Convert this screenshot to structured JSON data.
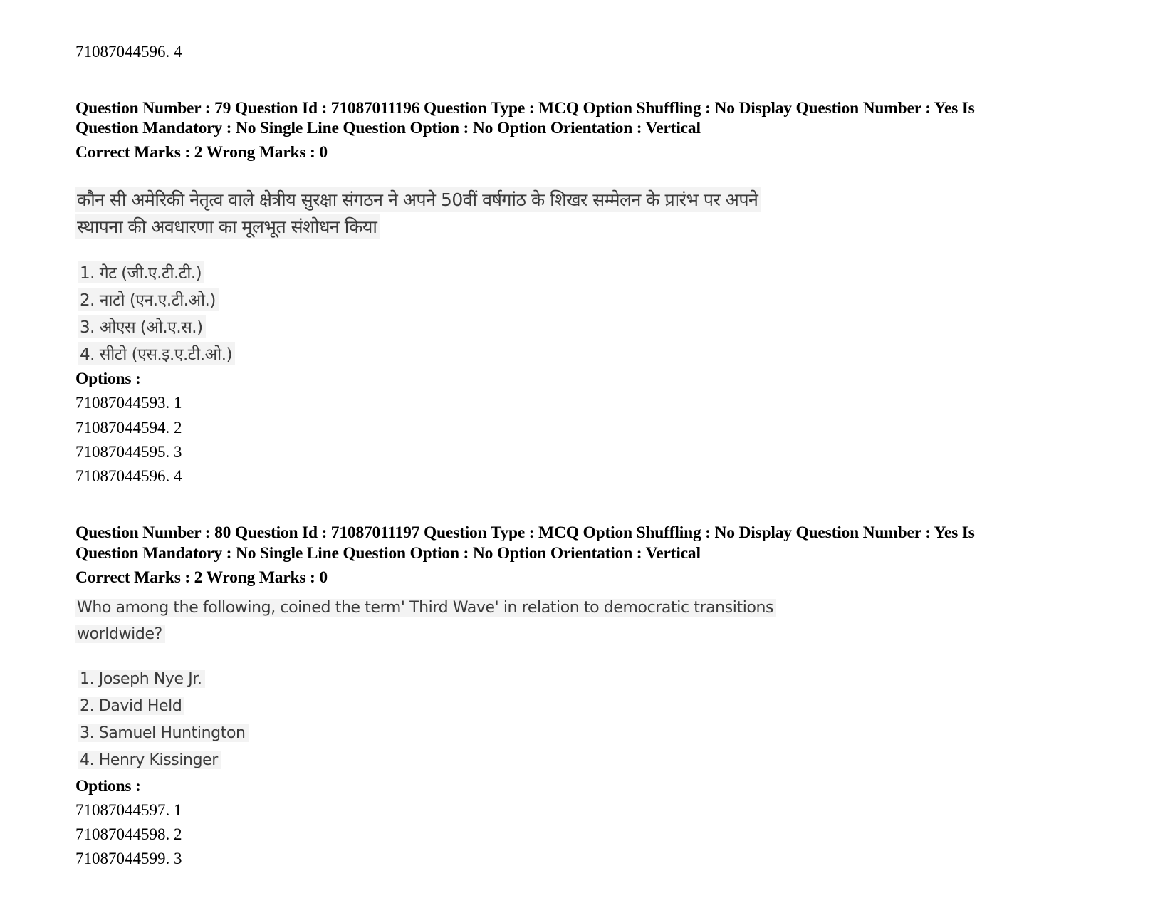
{
  "prev_question_tail": {
    "option_id": "71087044596. 4"
  },
  "questions": [
    {
      "header_line1": "Question Number : 79 Question Id : 71087011196 Question Type : MCQ Option Shuffling : No Display Question Number : Yes Is",
      "header_line2": "Question Mandatory : No Single Line Question Option : No Option Orientation : Vertical",
      "marks": "Correct Marks : 2 Wrong Marks : 0",
      "question_lines": [
        "कौन सी अमेरिकी नेतृत्व वाले क्षेत्रीय सुरक्षा संगठन ने अपने 50वीं वर्षगांठ के शिखर सम्मेलन के प्रारंभ पर अपने",
        "स्थापना की अवधारणा का मूलभूत संशोधन किया"
      ],
      "choices": [
        "1. गेट (जी.ए.टी.टी.)",
        "2. नाटो (एन.ए.टी.ओ.)",
        "3. ओएस (ओ.ए.स.)",
        "4. सीटो (एस.इ.ए.टी.ओ.)"
      ],
      "options_label": "Options :",
      "option_ids": [
        "71087044593. 1",
        "71087044594. 2",
        "71087044595. 3",
        "71087044596. 4"
      ]
    },
    {
      "header_line1": "Question Number : 80 Question Id : 71087011197 Question Type : MCQ Option Shuffling : No Display Question Number : Yes Is",
      "header_line2": "Question Mandatory : No Single Line Question Option : No Option Orientation : Vertical",
      "marks": "Correct Marks : 2 Wrong Marks : 0",
      "question_lines": [
        "Who among the following, coined the term' Third Wave' in relation to democratic transitions",
        "worldwide?"
      ],
      "choices": [
        "1. Joseph Nye Jr.",
        "2. David Held",
        "3. Samuel Huntington",
        "4. Henry Kissinger"
      ],
      "options_label": "Options :",
      "option_ids": [
        "71087044597. 1",
        "71087044598. 2",
        "71087044599. 3"
      ]
    }
  ]
}
